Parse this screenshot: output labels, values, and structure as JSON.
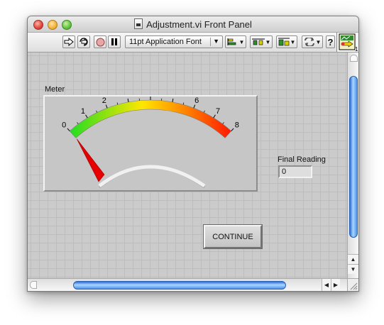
{
  "window": {
    "title": "Adjustment.vi Front Panel"
  },
  "toolbar": {
    "font_ring": "11pt Application Font",
    "connector_pane_number": "1",
    "icons": [
      "run-arrow-icon",
      "run-continuously-icon",
      "abort-icon",
      "pause-icon",
      "align-objects-icon",
      "distribute-objects-icon",
      "resize-objects-icon",
      "reorder-icon",
      "help-icon",
      "vi-icon"
    ]
  },
  "meter": {
    "label": "Meter",
    "scale": [
      "0",
      "1",
      "2",
      "3",
      "4",
      "5",
      "6",
      "7",
      "8"
    ],
    "min": 0,
    "max": 8,
    "needle_value": 0,
    "gradient_colors": [
      "#22dd22",
      "#ffe600",
      "#ff1a00"
    ]
  },
  "final_reading": {
    "label": "Final Reading",
    "value": "0"
  },
  "continue_button": {
    "label": "CONTINUE"
  },
  "scrollbars": {
    "accent_color": "#3a7fe0"
  }
}
